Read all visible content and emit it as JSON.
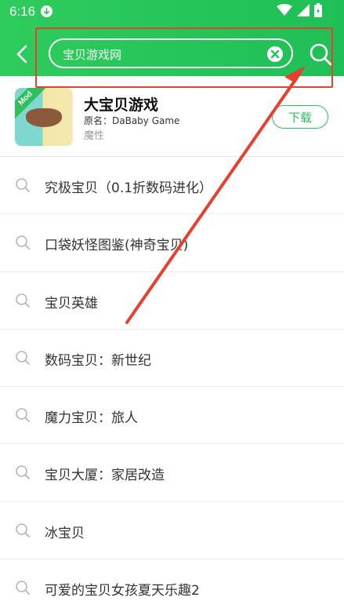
{
  "status_bar": {
    "time": "6:16",
    "download_icon": "download-arrow-icon",
    "wifi_icon": "wifi-icon",
    "signal_icon": "signal-icon",
    "battery_icon": "battery-charging-icon"
  },
  "header": {
    "background_color": "#22c55a",
    "back_icon": "chevron-left-icon",
    "search": {
      "value": "宝贝游戏网",
      "clear_icon": "clear-circle-icon"
    },
    "search_icon": "search-icon"
  },
  "annotation": {
    "color": "#e8402e"
  },
  "app_result": {
    "title": "大宝贝游戏",
    "original_name": "原名：DaBaby Game",
    "category": "魔性",
    "badge": "Mod",
    "download_label": "下载",
    "accent_color": "#2fbf5c"
  },
  "suggestions": [
    {
      "label": "究极宝贝（0.1折数码进化）"
    },
    {
      "label": "口袋妖怪图鉴(神奇宝贝)"
    },
    {
      "label": "宝贝英雄"
    },
    {
      "label": "数码宝贝：新世纪"
    },
    {
      "label": "魔力宝贝：旅人"
    },
    {
      "label": "宝贝大厦：家居改造"
    },
    {
      "label": "冰宝贝"
    },
    {
      "label": "可爱的宝贝女孩夏天乐趣2"
    }
  ]
}
